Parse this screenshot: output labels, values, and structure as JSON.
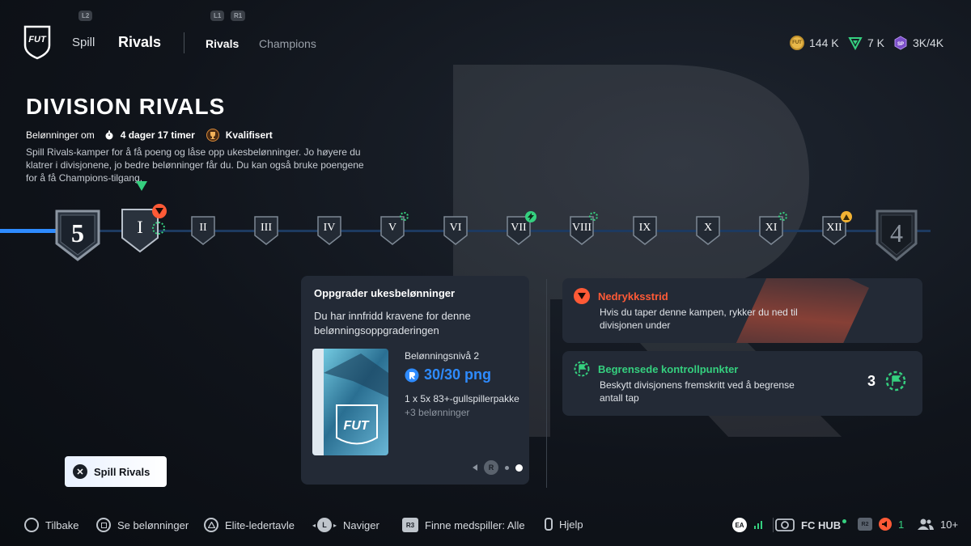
{
  "nav": {
    "l2": "L2",
    "l1": "L1",
    "r1": "R1",
    "logo": "FUT",
    "spill": "Spill",
    "rivals": "Rivals",
    "sub_rivals": "Rivals",
    "sub_champions": "Champions"
  },
  "currency": {
    "coins": "144 K",
    "points": "7 K",
    "sp": "3K/4K"
  },
  "header": {
    "title": "DIVISION RIVALS",
    "rewards_in": "Belønninger om",
    "time_left": "4 dager 17 timer",
    "qualified": "Kvalifisert",
    "description": "Spill Rivals-kamper for å få poeng og låse opp ukesbelønninger. Jo høyere du klatrer i divisjonene, jo bedre belønninger får du. Du kan også bruke poengene for å få Champions-tilgang."
  },
  "track": {
    "current_division": "5",
    "next_division": "4",
    "steps": [
      "I",
      "II",
      "III",
      "IV",
      "V",
      "VI",
      "VII",
      "VIII",
      "IX",
      "X",
      "XI",
      "XII"
    ],
    "fill_fraction": 0.08
  },
  "reward_card": {
    "title": "Oppgrader ukesbelønninger",
    "subtitle": "Du har innfridd kravene for denne belønningsoppgraderingen",
    "pack_label": "FUT",
    "level": "Belønningsnivå 2",
    "points": "30/30 png",
    "pack": "1 x 5x 83+-gullspillerpakke",
    "more": "+3 belønninger",
    "pager_button": "R"
  },
  "relegation": {
    "title": "Nedrykksstrid",
    "body": "Hvis du taper denne kampen, rykker du ned til divisjonen under",
    "color": "#ff5a36"
  },
  "checkpoints": {
    "title": "Begrensede kontrollpunkter",
    "body": "Beskytt divisjonens fremskritt ved å begrense antall tap",
    "count": "3",
    "color": "#35d07f"
  },
  "play_button": "Spill Rivals",
  "footer": {
    "back": "Tilbake",
    "rewards": "Se belønninger",
    "leaderboard": "Elite-ledertavle",
    "navigate": "Naviger",
    "navigate_key": "L",
    "find_teammate": "Finne medspiller: Alle",
    "find_key": "R3",
    "help": "Hjelp",
    "ea": "EA",
    "fc_hub": "FC HUB",
    "r2": "R2",
    "notifications": "1",
    "friends": "10+"
  }
}
